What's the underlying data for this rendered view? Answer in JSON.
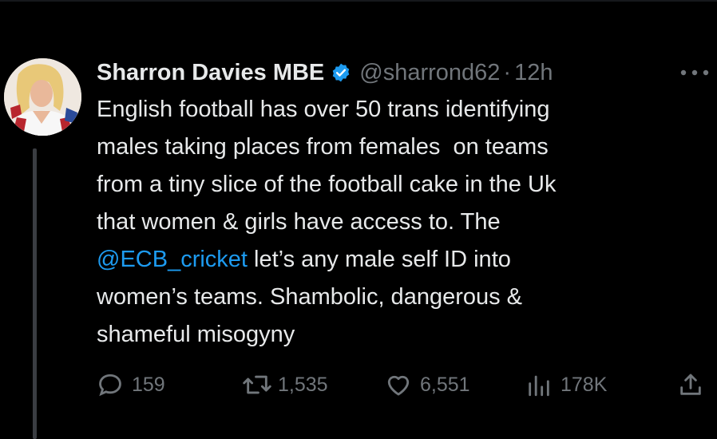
{
  "tweet": {
    "display_name": "Sharron Davies MBE",
    "handle": "@sharrond62",
    "separator": "·",
    "time": "12h",
    "text_lines": [
      "English football has over 50 trans identifying",
      "males taking places from females  on teams",
      "from a tiny slice of the football cake in the Uk",
      "that women & girls have access to. The"
    ],
    "mention": "@ECB_cricket",
    "line5_rest": " let’s any male self ID into",
    "text_lines_end": [
      "women’s teams. Shambolic, dangerous &",
      "shameful misogyny"
    ]
  },
  "actions": {
    "replies": "159",
    "reposts": "1,535",
    "likes": "6,551",
    "views": "178K"
  },
  "icons": {
    "verified": "verified-badge-icon",
    "more": "more-icon",
    "reply": "reply-icon",
    "repost": "repost-icon",
    "like": "heart-icon",
    "views": "views-icon",
    "share": "share-icon"
  },
  "colors": {
    "background": "#000000",
    "text": "#e7e9ea",
    "secondary": "#71767b",
    "accent": "#1d9bf0"
  }
}
